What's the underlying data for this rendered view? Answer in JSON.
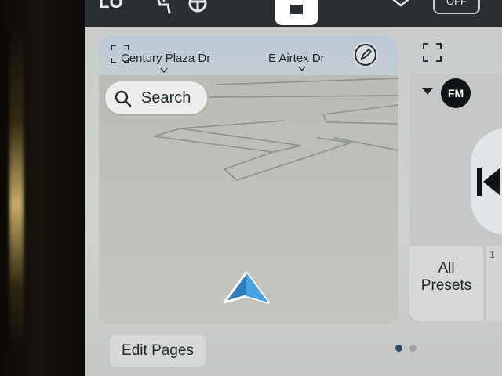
{
  "status_bar": {
    "fan_mode": "LO",
    "seat_icon": "seat-heater-icon",
    "wheel_icon": "steering-wheel-heater-icon",
    "home_icon": "home-grid-icon",
    "expand_icon": "chevron-down-icon",
    "right_pill": "OFF"
  },
  "map_card": {
    "expand_icon": "expand-corners-icon",
    "streets": [
      "Century Plaza Dr",
      "E Airtex Dr"
    ],
    "edit_icon": "pencil-icon",
    "search": {
      "label": "Search",
      "icon": "search-icon"
    },
    "vehicle_icon": "navigation-arrow-icon",
    "accent_color": "#3a8fd0"
  },
  "radio_card": {
    "expand_icon": "expand-corners-icon",
    "band": "FM",
    "skip_icon": "skip-back-icon",
    "presets_label": "All\nPresets",
    "preset_numbers": [
      "1"
    ]
  },
  "bottom_bar": {
    "edit_pages_label": "Edit Pages",
    "page_count": 2,
    "active_page": 1
  }
}
